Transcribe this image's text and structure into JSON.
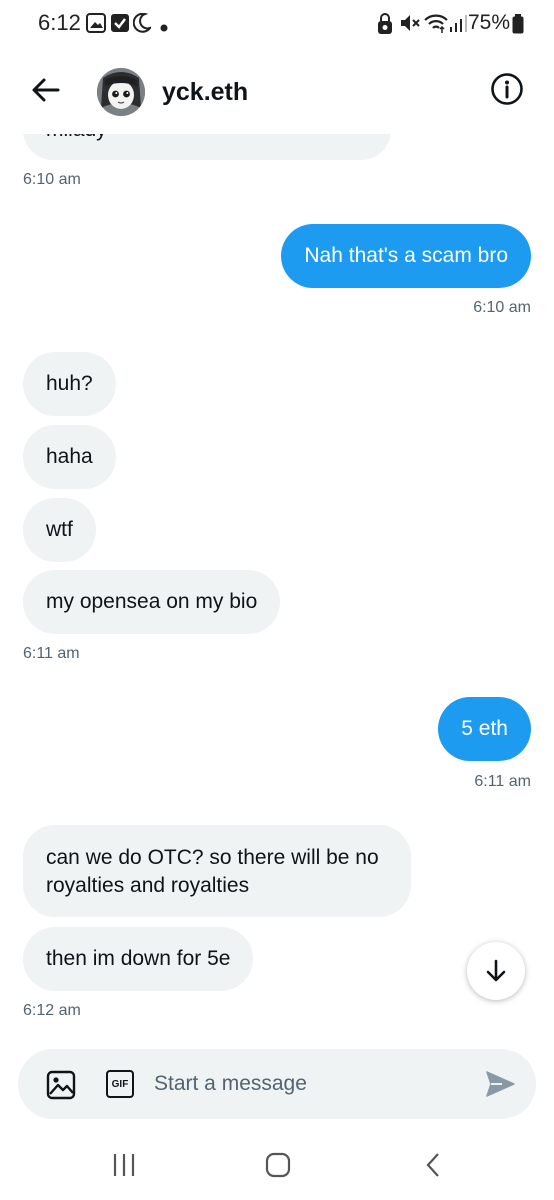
{
  "status_bar": {
    "time": "6:12",
    "battery": "75%"
  },
  "header": {
    "contact_name": "yck.eth"
  },
  "messages": [
    {
      "text": "milady",
      "dir": "in"
    },
    {
      "text": "6:10 am",
      "kind": "timestamp"
    },
    {
      "text": "Nah that's a scam bro",
      "dir": "out"
    },
    {
      "text": "6:10 am",
      "kind": "timestamp"
    },
    {
      "text": "huh?",
      "dir": "in"
    },
    {
      "text": "haha",
      "dir": "in"
    },
    {
      "text": "wtf",
      "dir": "in"
    },
    {
      "text": "my opensea on my bio",
      "dir": "in"
    },
    {
      "text": "6:11 am",
      "kind": "timestamp"
    },
    {
      "text": "5 eth",
      "dir": "out"
    },
    {
      "text": "6:11 am",
      "kind": "timestamp"
    },
    {
      "text": "can we do OTC? so there will be no royalties and royalties",
      "dir": "in"
    },
    {
      "text": "then im down for 5e",
      "dir": "in"
    },
    {
      "text": "6:12 am",
      "kind": "timestamp"
    }
  ],
  "composer": {
    "placeholder": "Start a message",
    "gif_label": "GIF"
  },
  "icons": {
    "back": "arrow-left-icon",
    "info": "info-icon",
    "scroll_down": "arrow-down-icon",
    "image": "image-icon",
    "gif": "gif-icon",
    "send": "send-icon"
  },
  "colors": {
    "outgoing_bubble": "#1d9bf0",
    "incoming_bubble": "#eff3f4",
    "timestamp": "#536471"
  }
}
